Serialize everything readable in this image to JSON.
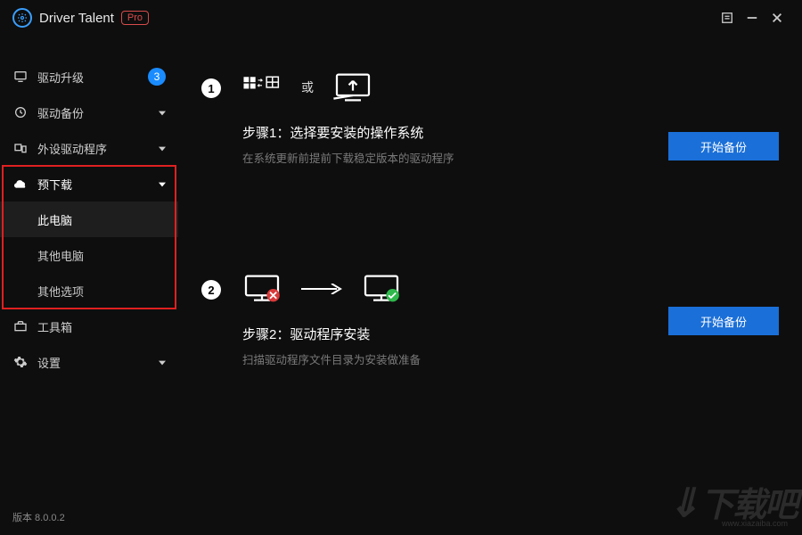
{
  "app": {
    "title": "Driver Talent",
    "pro_badge": "Pro"
  },
  "sidebar": {
    "items": [
      {
        "label": "驱动升级",
        "badge": "3"
      },
      {
        "label": "驱动备份"
      },
      {
        "label": "外设驱动程序"
      },
      {
        "label": "预下载"
      },
      {
        "label": "工具箱"
      },
      {
        "label": "设置"
      }
    ],
    "sub_items": [
      {
        "label": "此电脑"
      },
      {
        "label": "其他电脑"
      },
      {
        "label": "其他选项"
      }
    ]
  },
  "main": {
    "step1": {
      "num": "1",
      "or": "或",
      "title": "步骤1：选择要安装的操作系统",
      "desc": "在系统更新前提前下载稳定版本的驱动程序",
      "button": "开始备份"
    },
    "step2": {
      "num": "2",
      "title": "步骤2：驱动程序安装",
      "desc": "扫描驱动程序文件目录为安装做准备",
      "button": "开始备份"
    }
  },
  "footer": {
    "version": "版本 8.0.0.2"
  },
  "watermark": {
    "text": "下载吧",
    "url": "www.xiazaiba.com"
  }
}
